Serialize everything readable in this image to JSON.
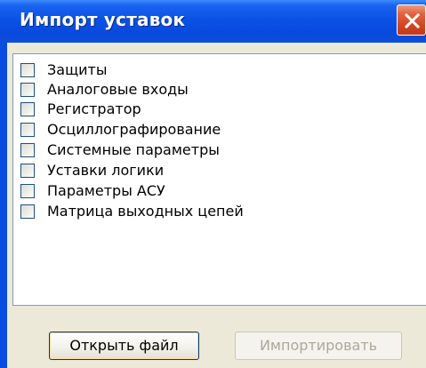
{
  "window": {
    "title": "Импорт уставок"
  },
  "icons": {
    "close": "close-icon"
  },
  "list": {
    "items": [
      {
        "label": "Защиты",
        "checked": false
      },
      {
        "label": "Аналоговые входы",
        "checked": false
      },
      {
        "label": "Регистратор",
        "checked": false
      },
      {
        "label": "Осциллографирование",
        "checked": false
      },
      {
        "label": "Системные параметры",
        "checked": false
      },
      {
        "label": "Уставки логики",
        "checked": false
      },
      {
        "label": "Параметры АСУ",
        "checked": false
      },
      {
        "label": "Матрица выходных цепей",
        "checked": false
      }
    ]
  },
  "buttons": {
    "open_file": "Открыть файл",
    "import": "Импортировать",
    "import_enabled": false
  },
  "colors": {
    "titlebar": "#0a52e4",
    "close_button": "#d24522",
    "dialog_background": "#ece9d8",
    "disabled_text": "#aca899"
  }
}
